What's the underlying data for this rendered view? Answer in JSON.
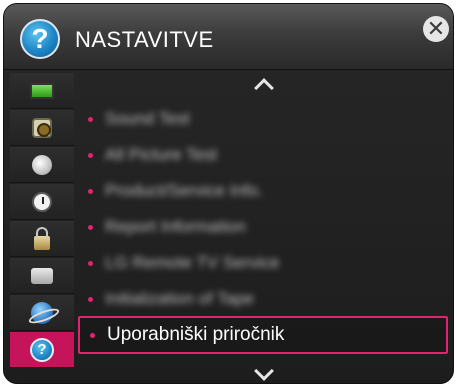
{
  "header": {
    "badge_glyph": "?",
    "title": "NASTAVITVE",
    "close_glyph": "✕"
  },
  "sidebar": {
    "items": [
      {
        "icon": "tv-picture-icon"
      },
      {
        "icon": "speaker-sound-icon"
      },
      {
        "icon": "satellite-dish-icon"
      },
      {
        "icon": "clock-time-icon"
      },
      {
        "icon": "padlock-icon"
      },
      {
        "icon": "briefcase-option-icon"
      },
      {
        "icon": "globe-network-icon"
      },
      {
        "icon": "help-support-icon",
        "selected": true,
        "glyph": "?"
      }
    ]
  },
  "menu": {
    "items": [
      {
        "label": "Sound Test",
        "blurred": true
      },
      {
        "label": "All Picture Test",
        "blurred": true
      },
      {
        "label": "Product/Service Info.",
        "blurred": true
      },
      {
        "label": "Report Information",
        "blurred": true
      },
      {
        "label": "LG Remote TV Service",
        "blurred": true
      },
      {
        "label": "Initialization of Tape",
        "blurred": true
      },
      {
        "label": "Uporabniški priročnik",
        "blurred": false,
        "active": true
      }
    ]
  },
  "colors": {
    "accent": "#e0246d",
    "selected_sidebar": "#c6145a",
    "panel": "#1d1d1d",
    "text": "#ffffff"
  }
}
